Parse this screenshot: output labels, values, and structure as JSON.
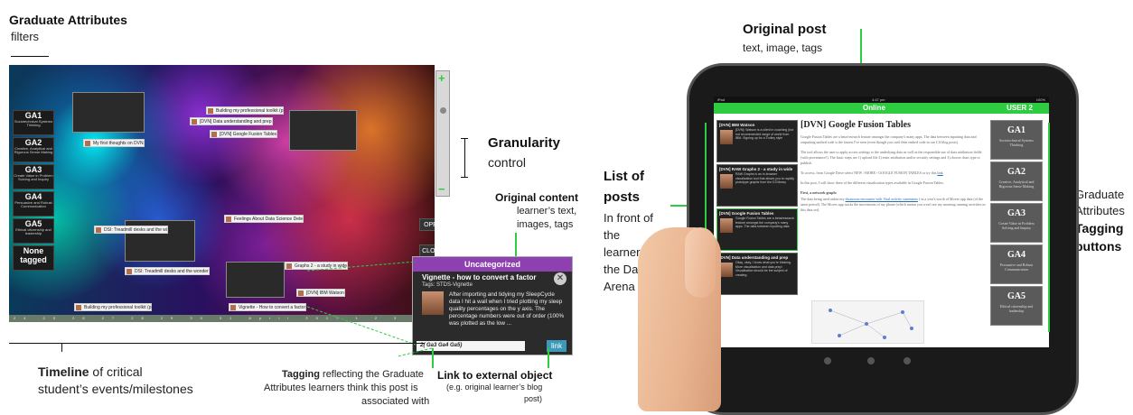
{
  "left_annotations": {
    "ga_title": "Graduate Attributes",
    "ga_sub": "filters",
    "granularity_title": "Granularity",
    "granularity_sub": "control",
    "orig_content_title": "Original content",
    "orig_content_l1": "learner’s text,",
    "orig_content_l2": "images, tags",
    "timeline_bold": "Timeline",
    "timeline_rest": " of critical",
    "timeline_l2": "student’s events/milestones",
    "tagging_bold": "Tagging",
    "tagging_rest": " reflecting the Graduate",
    "tagging_l2": "Attributes learners think this post is",
    "tagging_l3": "associated with",
    "link_bold": "Link to external object",
    "link_l2": "(e.g. original learner’s blog",
    "link_l3": "post)"
  },
  "arena": {
    "filters": [
      {
        "code": "GA1",
        "desc": "Sociotechnical Systems Thinking"
      },
      {
        "code": "GA2",
        "desc": "Creative, Analytical and Rigorous Sense Making"
      },
      {
        "code": "GA3",
        "desc": "Create Value in Problem Solving and Inquiry"
      },
      {
        "code": "GA4",
        "desc": "Persuasive and Robust Communication"
      },
      {
        "code": "GA5",
        "desc": "Ethical citizenship and leadership"
      },
      {
        "code": "None",
        "desc": "tagged"
      }
    ],
    "chips": [
      "My first thoughts on DVN",
      "Building my professional toolkit (p",
      "[DVN] Data understanding and prep",
      "[DVN] Google Fusion Tables",
      "Feelings About Data Science Dete",
      "DSI: Treadmill desks and the wi",
      "DSI: Treadmill desks and the wonder",
      "Graphs 2 - a study in wide",
      "[DVN] IBM Watson",
      "Vignette - How to convert a factor",
      "Building my professional toolkit (p"
    ],
    "timeline_ticks": "24 25 26 27 28 29 30 31 April 2017 1 2 3 4 5 6 7 8 9 10 11 12 13 14 15 16 17 18 19 20",
    "open_all": "OPEN ALL",
    "close_all": "CLOSE ALL",
    "plus": "+",
    "minus": "−"
  },
  "popup": {
    "header": "Uncategorized",
    "title": "Vignette - how to convert a factor",
    "tags": "Tags: STDS-Vignette",
    "body": "After importing and tidying my SleepCycle data I hit a wall when I tried plotting my sleep quality percentages on the y axis. The percentage numbers were out of order (100% was plotted as the low ...",
    "tagline": "2( Ga3 Ga4 Ga5)",
    "link": "link",
    "close": "✕"
  },
  "right_annotations": {
    "orig_post_title": "Original post",
    "orig_post_sub": "text, image, tags",
    "list_title_l1": "List of",
    "list_title_l2": "posts",
    "list_sub_l1": "In front of",
    "list_sub_l2": "the",
    "list_sub_l3": "learner in",
    "list_sub_l4": "the Data",
    "list_sub_l5": "Arena",
    "ga_tag_l1": "Graduate",
    "ga_tag_l2": "Attributes",
    "ga_tag_l3": "Tagging",
    "ga_tag_l4": "buttons"
  },
  "tablet": {
    "status_left": "iPad",
    "status_center": "4:47 pm",
    "status_right": "100%",
    "online": "Online",
    "user": "USER 2",
    "posts": [
      {
        "title": "[DVN] IBM Watson",
        "text": "[DVN]: Watson is a client in coaching (but not recommended range of world from IBM. Signing up for a Trolley style"
      },
      {
        "title": "[DVN] RAW Graphs 2 - a study in wide",
        "text": "RAW Graphs is an in-browser visualization tool that allows you to rapidly prototype graphs from the D3 library"
      },
      {
        "title": "[DVN] Google Fusion Tables",
        "text": "Google Fusion Tables are a beta/research feature amongst the company's many apps. The data between inputting data"
      },
      {
        "title": "[DVN] Data understanding and prep",
        "text": "Okay, okay, I know what you're thinking. More visualisation and data prep! Visualisation should be the subject of creating"
      }
    ],
    "article_title": "[DVN] Google Fusion Tables",
    "p1": "Google Fusion Tables are a beta/research feature amongst the company's many apps. The data between inputting data and outputting unified code is the fastest I've seen (even though you can't then embed code in our CA blog posts).",
    "p2": "The tool allows the user to apply access settings to the underlying data as well as the responsible use of data attribution fields (with provenance!). The basic steps are 1) upload file 2) enter attribution and/or security settings and 3) choose chart type to publish.",
    "p3_pre": "To access, from Google Drive select NEW >MORE> GOOGLE FUSION TABLES or try this ",
    "p3_link": "link",
    "p4": "In this post, I will show three of the different visualisation types available in Google Fusion Tables.",
    "p5_head": "First, a network graph:",
    "p5_pre": "The data being used rather my ",
    "p5_link": "disastrous encounter with Vital activity statements",
    "p5_post": " ( in a year's worth of Moves app data (of the same period). The Moves app tracks the movements of my phone (which means you won't see my morning running activities in this data set).",
    "buttons": [
      {
        "code": "GA1",
        "desc": "Sociotechnical Systems Thinking"
      },
      {
        "code": "GA2",
        "desc": "Creative, Analytical and Rigorous Sense Making"
      },
      {
        "code": "GA3",
        "desc": "Create Value in Problem Solving and Inquiry"
      },
      {
        "code": "GA4",
        "desc": "Persuasive and Robust Communication"
      },
      {
        "code": "GA5",
        "desc": "Ethical citizenship and leadership"
      }
    ]
  }
}
